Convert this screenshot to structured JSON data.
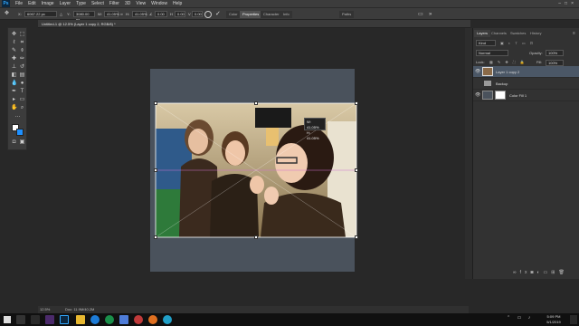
{
  "menubar": {
    "logo": "Ps",
    "items": [
      "File",
      "Edit",
      "Image",
      "Layer",
      "Type",
      "Select",
      "Filter",
      "3D",
      "View",
      "Window",
      "Help"
    ]
  },
  "options": {
    "x_label": "X:",
    "x_value": "6067.22 px",
    "y_label": "Y:",
    "y_value": "3080.00 px",
    "w_label": "W:",
    "w_value": "41.05%",
    "h_label": "H:",
    "h_value": "41.05%",
    "angle_value": "0.00",
    "h_skew_value": "0.00",
    "v_skew_value": "0.00",
    "tabs": [
      "Color",
      "Properties",
      "Character",
      "Info"
    ],
    "active_tab": "Properties",
    "paths_tab": "Paths"
  },
  "document": {
    "tab_title": "Untitled-1 @ 12.5% (Layer 1 copy 2, RGB/8) *",
    "zoom": "12.5%",
    "doc_info": "Doc: 11.9M/40.2M",
    "transform_tooltip_w": "W: 41.05%",
    "transform_tooltip_h": "H: 41.05%"
  },
  "layers_panel": {
    "tabs": [
      "Layers",
      "Channels",
      "Swatches",
      "History"
    ],
    "active_tab": "Layers",
    "kind_label": "Kind",
    "blend_mode": "Normal",
    "opacity_label": "Opacity:",
    "opacity_value": "100%",
    "lock_label": "Lock:",
    "fill_label": "Fill:",
    "fill_value": "100%",
    "layers": [
      {
        "name": "Layer 1 copy 2",
        "visible": true
      },
      {
        "name": "Backup",
        "visible": false
      },
      {
        "name": "Color Fill 1",
        "visible": true
      }
    ]
  },
  "taskbar": {
    "time": "5:09 PM",
    "date": "5/1/2019"
  },
  "colors": {
    "foreground": "#1e90ff",
    "background": "#ffffff",
    "accent": "#31a8ff"
  }
}
